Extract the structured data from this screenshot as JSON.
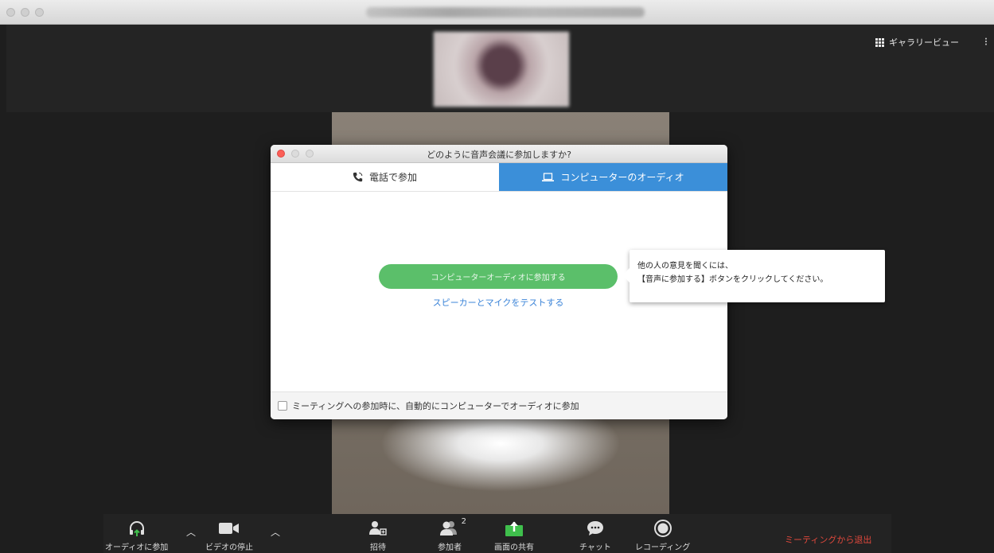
{
  "dialog": {
    "title": "どのように音声会議に参加しますか?",
    "tabs": [
      {
        "label": "電話で参加",
        "icon": "phone-icon",
        "active": false
      },
      {
        "label": "コンピューターのオーディオ",
        "icon": "laptop-icon",
        "active": true
      }
    ],
    "join_button": "コンピューターオーディオに参加する",
    "test_link": "スピーカーとマイクをテストする",
    "auto_join_label": "ミーティングへの参加時に、自動的にコンピューターでオーディオに参加",
    "auto_join_checked": false
  },
  "tooltip": {
    "line1": "他の人の意見を聞くには、",
    "line2": "【音声に参加する】ボタンをクリックしてください。"
  },
  "header": {
    "gallery_view": "ギャラリービュー"
  },
  "toolbar": {
    "audio": "オーディオに参加",
    "video": "ビデオの停止",
    "invite": "招待",
    "participants": "参加者",
    "participants_count": "2",
    "share": "画面の共有",
    "chat": "チャット",
    "record": "レコーディング",
    "leave": "ミーティングから退出"
  },
  "colors": {
    "accent_tab": "#3b8fd9",
    "join_button": "#5bbf6a",
    "share_icon": "#3fbf4c",
    "leave_text": "#e0483c",
    "audio_arrow": "#3fbf4c"
  }
}
